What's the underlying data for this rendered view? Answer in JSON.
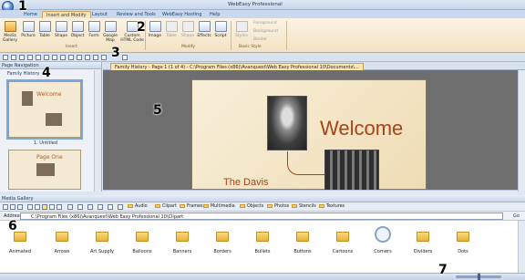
{
  "window": {
    "title": "WebEasy Professional"
  },
  "ribbon_tabs": [
    "Home",
    "Insert and Modify",
    "Layout",
    "Review and Tools",
    "WebEasy Hosting",
    "Help"
  ],
  "ribbon": {
    "insert_buttons": [
      "Media Gallery",
      "Picture",
      "Table",
      "Shape",
      "Object",
      "Form",
      "Google Map",
      "Custom HTML Code"
    ],
    "insert_group": "Insert",
    "modify_buttons": [
      "Image",
      "Table",
      "Shape",
      "Effects",
      "Script"
    ],
    "modify_group": "Modify",
    "styles_button": "Styles",
    "style_options": [
      "Foreground",
      "Background",
      "Border"
    ],
    "basic_style_group": "Basic Style"
  },
  "page_navigation": {
    "header": "Page Navigation",
    "site_name": "Family History",
    "thumbs": [
      {
        "title": "Welcome",
        "label": "1. Untitled"
      },
      {
        "title": "Page One",
        "label": ""
      }
    ]
  },
  "document": {
    "tab_label": "Family History - Page 1 (1 of 4) - C:\\Program Files (x86)\\Avanquest\\Web Easy Professional 10\\Documents\\...",
    "welcome_text": "Welcome",
    "family_text": "The Davis"
  },
  "media_gallery": {
    "header": "Media Gallery",
    "categories": [
      "Audio",
      "Clipart",
      "Frames",
      "Multimedia",
      "Objects",
      "Photos",
      "Stencils",
      "Textures"
    ],
    "address_label": "Address",
    "address_value": "C:\\Program Files (x86)\\Avanquest\\Web Easy Professional 10\\Clipart",
    "go_label": "Go",
    "items": [
      "Animated",
      "Arrows",
      "Art Supply",
      "Balloons",
      "Banners",
      "Borders",
      "Bullets",
      "Buttons",
      "Cartoons",
      "Corners",
      "Dividers",
      "Dots"
    ]
  },
  "callouts": [
    "1",
    "2",
    "3",
    "4",
    "5",
    "6",
    "7"
  ],
  "colors": {
    "accent": "#a8431a",
    "ribbon_bg": "#f3e3c4",
    "canvas_bg": "#6e6e6e"
  }
}
